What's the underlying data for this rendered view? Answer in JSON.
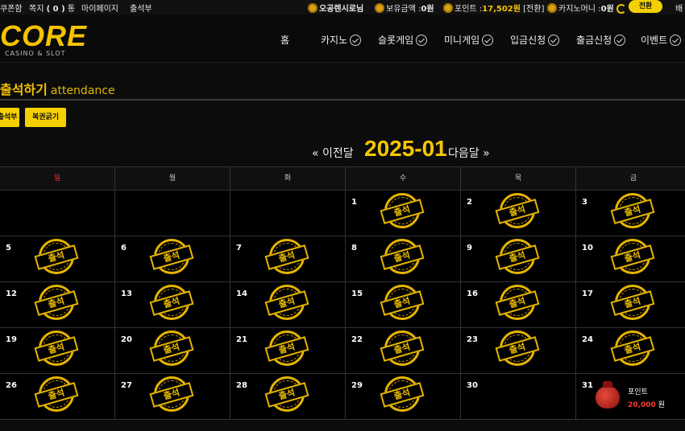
{
  "topbar": {
    "coupon": "쿠폰함",
    "message_prefix": "쪽지",
    "message_count": "( 0 )",
    "message_suffix": "통",
    "mypage": "마이페이지",
    "attendance": "출석부",
    "username": "오공렌시로님",
    "balance_label": "보유금액 :",
    "balance_value": "0원",
    "points_label": "포인트 :",
    "points_value": "17,502원",
    "points_convert": "[전환]",
    "casino_money_label": "카지노머니 :",
    "casino_money_value": "0원",
    "convert_button": "전환",
    "overflow": "배"
  },
  "header": {
    "logo": "CORE",
    "logo_sub": "CASINO & SLOT",
    "nav": [
      "홈",
      "카지노",
      "슬롯게임",
      "미니게임",
      "입금신청",
      "출금신청",
      "이벤트"
    ]
  },
  "page": {
    "title_ko": "출석하기",
    "title_en": "attendance",
    "tab_attendance": "출석부",
    "tab_lottery": "복권긁기"
  },
  "month_nav": {
    "prev": "« 이전달",
    "current": "2025-01",
    "next": "다음달 »"
  },
  "calendar": {
    "weekdays": [
      "일",
      "월",
      "화",
      "수",
      "목",
      "금"
    ],
    "stamp_text": "출석",
    "rows": [
      [
        null,
        null,
        null,
        1,
        2,
        3
      ],
      [
        5,
        6,
        7,
        8,
        9,
        10
      ],
      [
        12,
        13,
        14,
        15,
        16,
        17
      ],
      [
        19,
        20,
        21,
        22,
        23,
        24
      ],
      [
        26,
        27,
        28,
        29,
        30,
        31
      ]
    ],
    "stamped": [
      1,
      2,
      3,
      5,
      6,
      7,
      8,
      9,
      10,
      12,
      13,
      14,
      15,
      16,
      17,
      19,
      20,
      21,
      22,
      23,
      24,
      26,
      27,
      28,
      29
    ],
    "reward": {
      "day": 31,
      "label": "포인트",
      "amount": "20,000",
      "unit": "원"
    }
  },
  "colors": {
    "accent": "#f5c800",
    "sunday": "#ff2a2a",
    "reward_amount": "#ff3b2f"
  }
}
